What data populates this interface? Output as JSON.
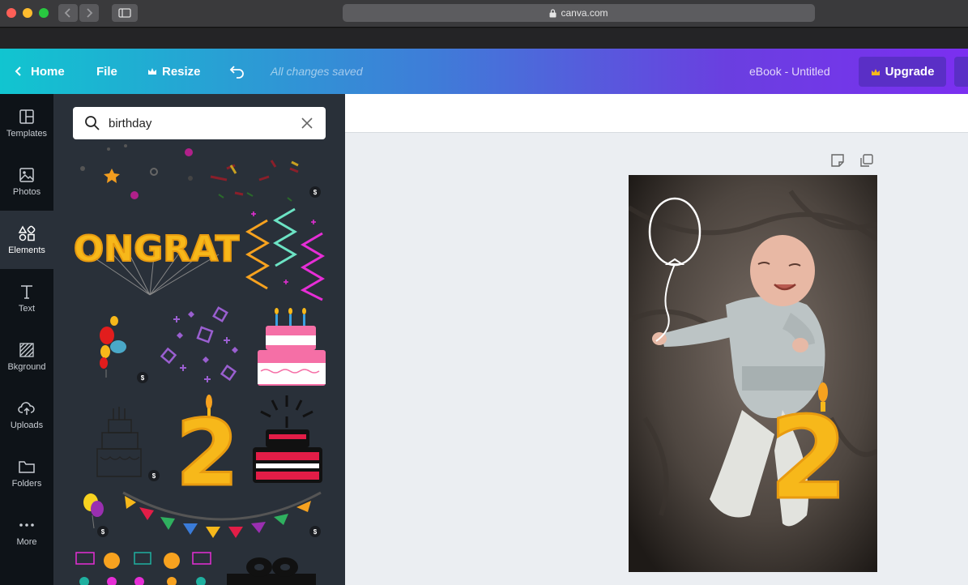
{
  "browser": {
    "url": "canva.com"
  },
  "topbar": {
    "home_label": "Home",
    "file_label": "File",
    "resize_label": "Resize",
    "save_status": "All changes saved",
    "doc_title": "eBook - Untitled",
    "upgrade_label": "Upgrade"
  },
  "sidebar": {
    "items": [
      {
        "label": "Templates",
        "icon": "templates-icon"
      },
      {
        "label": "Photos",
        "icon": "photos-icon"
      },
      {
        "label": "Elements",
        "icon": "elements-icon"
      },
      {
        "label": "Text",
        "icon": "text-icon"
      },
      {
        "label": "Bkground",
        "icon": "background-icon"
      },
      {
        "label": "Uploads",
        "icon": "uploads-icon"
      },
      {
        "label": "Folders",
        "icon": "folders-icon"
      },
      {
        "label": "More",
        "icon": "more-icon"
      }
    ]
  },
  "elements_panel": {
    "search_value": "birthday",
    "price_badge": "$",
    "congrats_text": "CONGRATS",
    "number_text": "2"
  },
  "canvas": {
    "number_text": "2"
  },
  "colors": {
    "accent_start": "#11c5d0",
    "accent_end": "#7b2ff0",
    "upgrade": "#5a2fc6",
    "panel": "#293039",
    "rail": "#0e1318"
  }
}
